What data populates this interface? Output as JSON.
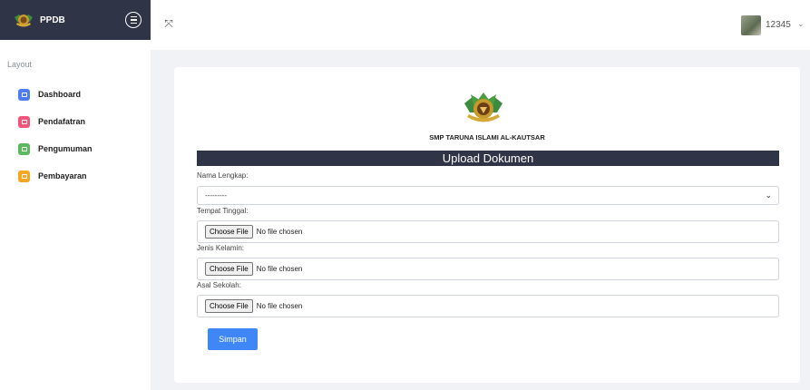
{
  "sidebar": {
    "brand_title": "PPDB",
    "section_title": "Layout",
    "items": [
      {
        "label": "Dashboard",
        "icon": "home-icon",
        "color": "#4d7cf4"
      },
      {
        "label": "Pendafatran",
        "icon": "grid-icon",
        "color": "#f2557a"
      },
      {
        "label": "Pengumuman",
        "icon": "megaphone-icon",
        "color": "#5cb85c"
      },
      {
        "label": "Pembayaran",
        "icon": "wallet-icon",
        "color": "#f5a623"
      }
    ]
  },
  "topbar": {
    "expand_icon": "expand-icon",
    "user_name": "12345",
    "caret": "⌄"
  },
  "form": {
    "school_name": "SMP TARUNA ISLAMI AL-KAUTSAR",
    "header": "Upload Dokumen",
    "fields": [
      {
        "label": "Nama Lengkap:",
        "type": "select",
        "value": "---------"
      },
      {
        "label": "Tempat Tinggal:",
        "type": "file",
        "button": "Choose File",
        "status": "No file chosen"
      },
      {
        "label": "Jenis Kelamin:",
        "type": "file",
        "button": "Choose File",
        "status": "No file chosen"
      },
      {
        "label": "Asal Sekolah:",
        "type": "file",
        "button": "Choose File",
        "status": "No file chosen"
      }
    ],
    "submit_label": "Simpan"
  },
  "colors": {
    "dark_header": "#2f3447",
    "primary_button": "#3f86f7"
  }
}
